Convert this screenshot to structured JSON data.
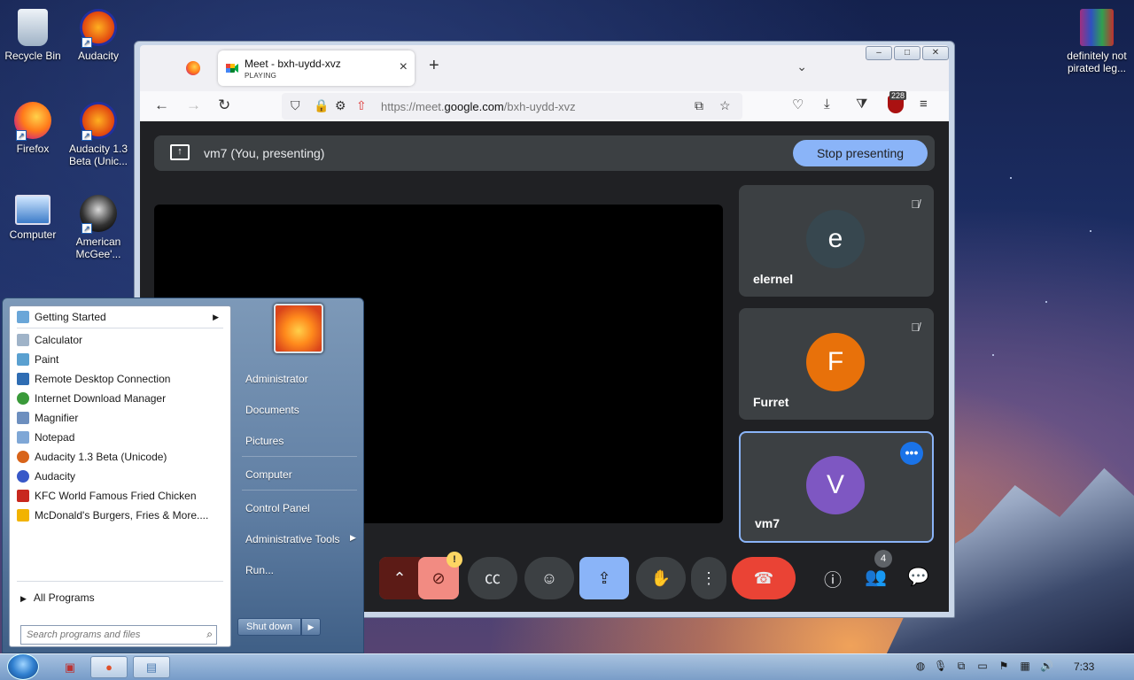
{
  "desktop": {
    "icons": [
      {
        "label": "Recycle Bin",
        "icon": "recycle-bin-icon"
      },
      {
        "label": "Audacity",
        "icon": "audacity-icon"
      },
      {
        "label": "Firefox",
        "icon": "firefox-icon"
      },
      {
        "label": "Audacity 1.3 Beta (Unic...",
        "icon": "audacity-icon"
      },
      {
        "label": "Computer",
        "icon": "computer-icon"
      },
      {
        "label": "American McGee'...",
        "icon": "alice-game-icon"
      },
      {
        "label": "definitely not pirated leg...",
        "icon": "winrar-icon"
      }
    ]
  },
  "browser": {
    "tab_title": "Meet - bxh-uydd-xvz",
    "tab_subtitle": "PLAYING",
    "url_prefix": "https://meet.",
    "url_domain": "google.com",
    "url_path": "/bxh-uydd-xvz",
    "ublock_count": "228",
    "window_buttons": [
      "–",
      "□",
      "✕"
    ]
  },
  "meet": {
    "presenting_label": "vm7 (You, presenting)",
    "stop_button": "Stop presenting",
    "participants": [
      {
        "initial": "e",
        "name": "elernel",
        "color": "#37474f",
        "muted": true
      },
      {
        "initial": "F",
        "name": "Furret",
        "color": "#e8710a",
        "muted": true
      },
      {
        "initial": "V",
        "name": "vm7",
        "color": "#7e57c2",
        "muted": false
      }
    ],
    "people_count": "4",
    "warning_badge": "!"
  },
  "start_menu": {
    "programs": [
      {
        "label": "Getting Started",
        "icon_color": "#6aa6d8",
        "submenu": true
      },
      {
        "label": "Calculator",
        "icon_color": "#9fb3c8"
      },
      {
        "label": "Paint",
        "icon_color": "#5aa0d0"
      },
      {
        "label": "Remote Desktop Connection",
        "icon_color": "#2f6db3"
      },
      {
        "label": "Internet Download Manager",
        "icon_color": "#3a9a3a"
      },
      {
        "label": "Magnifier",
        "icon_color": "#6d8fbf"
      },
      {
        "label": "Notepad",
        "icon_color": "#7fa7d6"
      },
      {
        "label": "Audacity 1.3 Beta (Unicode)",
        "icon_color": "#d8641a"
      },
      {
        "label": "Audacity",
        "icon_color": "#3858c8"
      },
      {
        "label": "KFC  World Famous Fried Chicken",
        "icon_color": "#c8281e"
      },
      {
        "label": "McDonald's  Burgers, Fries & More....",
        "icon_color": "#f2b300"
      }
    ],
    "all_programs": "All Programs",
    "search_placeholder": "Search programs and files",
    "right_items": [
      "Administrator",
      "Documents",
      "Pictures",
      "Computer",
      "Control Panel",
      "Administrative Tools",
      "Run..."
    ],
    "shutdown": "Shut down"
  },
  "taskbar": {
    "clock": "7:33"
  }
}
